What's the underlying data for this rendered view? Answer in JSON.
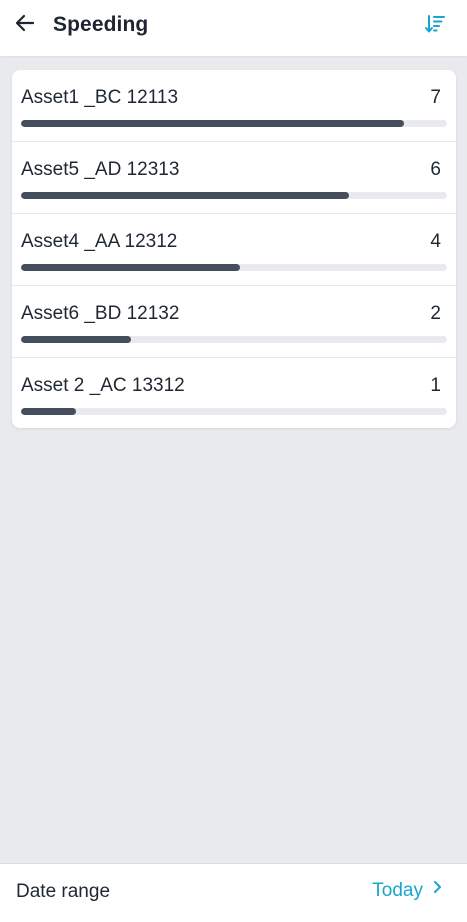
{
  "header": {
    "title": "Speeding",
    "back_icon": "arrow-left-icon",
    "sort_icon": "sort-descending-icon"
  },
  "colors": {
    "accent": "#1aa5cf",
    "bar_fill": "#454e5c",
    "bar_track": "#e9eaed",
    "background": "#e9eaed"
  },
  "list": {
    "max_value": 7,
    "items": [
      {
        "name": "Asset1 _BC 12113",
        "count": "7",
        "value": 7,
        "fill_fraction": 0.9
      },
      {
        "name": "Asset5 _AD 12313",
        "count": "6",
        "value": 6,
        "fill_fraction": 0.77
      },
      {
        "name": "Asset4 _AA 12312",
        "count": "4",
        "value": 4,
        "fill_fraction": 0.515
      },
      {
        "name": "Asset6 _BD 12132",
        "count": "2",
        "value": 2,
        "fill_fraction": 0.258
      },
      {
        "name": "Asset 2 _AC 13312",
        "count": "1",
        "value": 1,
        "fill_fraction": 0.129
      }
    ]
  },
  "footer": {
    "label": "Date range",
    "value": "Today",
    "chevron_icon": "chevron-right-icon"
  }
}
